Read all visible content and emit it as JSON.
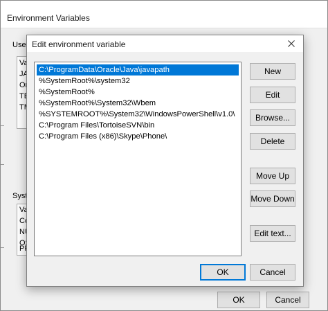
{
  "background_window": {
    "title": "Environment Variables",
    "user_group_label": "User",
    "user_list_header": "Va",
    "user_list_items": [
      "JAV",
      "On",
      "TEI",
      "TM"
    ],
    "system_group_label": "Syste",
    "system_list_header": "Va",
    "system_list_items": [
      "Co",
      "NU",
      "OS",
      "PR"
    ],
    "ok_label": "OK",
    "cancel_label": "Cancel"
  },
  "dialog": {
    "title": "Edit environment variable",
    "paths": [
      "C:\\ProgramData\\Oracle\\Java\\javapath",
      "%SystemRoot%\\system32",
      "%SystemRoot%",
      "%SystemRoot%\\System32\\Wbem",
      "%SYSTEMROOT%\\System32\\WindowsPowerShell\\v1.0\\",
      "C:\\Program Files\\TortoiseSVN\\bin",
      "C:\\Program Files (x86)\\Skype\\Phone\\"
    ],
    "selected_index": 0,
    "buttons": {
      "new": "New",
      "edit": "Edit",
      "browse": "Browse...",
      "delete": "Delete",
      "move_up": "Move Up",
      "move_down": "Move Down",
      "edit_text": "Edit text..."
    },
    "ok_label": "OK",
    "cancel_label": "Cancel"
  },
  "icons": {
    "close": "close-icon"
  },
  "colors": {
    "selection": "#0078d7",
    "dialog_background": "#f0f0f0",
    "button_background": "#e1e1e1"
  }
}
